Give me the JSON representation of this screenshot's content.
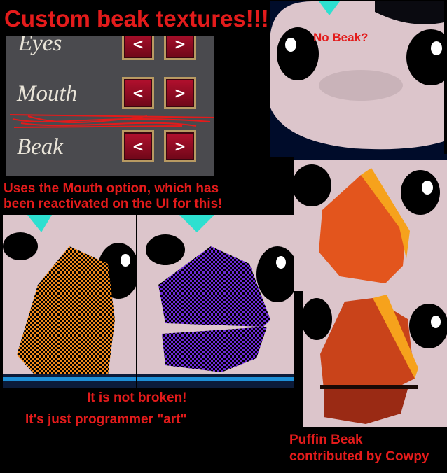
{
  "title": "Custom beak textures!!!",
  "options_panel": {
    "rows": [
      {
        "label": "Eyes",
        "prev": "<",
        "next": ">"
      },
      {
        "label": "Mouth",
        "prev": "<",
        "next": ">"
      },
      {
        "label": "Beak",
        "prev": "<",
        "next": ">"
      }
    ]
  },
  "captions": {
    "no_beak": "No Beak?",
    "mouth_note_line1": "Uses the Mouth option, which has",
    "mouth_note_line2": "been reactivated on the UI for this!",
    "not_broken": "It is not broken!",
    "programmer_art": "It's just programmer \"art\"",
    "puffin_line1": "Puffin Beak",
    "puffin_line2": "contributed by Cowpy"
  },
  "colors": {
    "caption_red": "#e31b1b",
    "panel_bg": "#4a4a4e",
    "button_red": "#9e0c26",
    "button_border": "#b89a62",
    "bird_pink": "#dcc5cb",
    "beak_orange": "#e3551d",
    "beak_purple": "#4d1aa6",
    "checker_orange": "#f08a1c",
    "crest_cyan": "#2de0d0"
  }
}
